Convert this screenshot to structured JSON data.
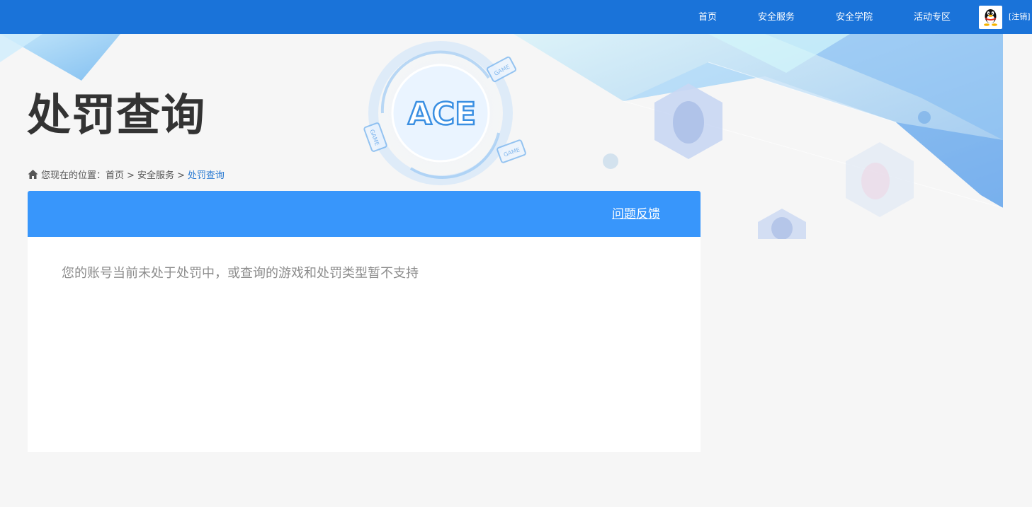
{
  "nav": {
    "items": [
      {
        "label": "首页"
      },
      {
        "label": "安全服务"
      },
      {
        "label": "安全学院"
      },
      {
        "label": "活动专区"
      }
    ],
    "logout_label": "[注销]",
    "avatar_icon": "qq-penguin-icon",
    "bar_color": "#1a73d9"
  },
  "banner": {
    "logo_text": "ACE",
    "badge_text": "GAME"
  },
  "page": {
    "title": "处罚查询"
  },
  "breadcrumb": {
    "prefix": "您现在的位置：",
    "items": [
      "首页",
      "安全服务",
      "处罚查询"
    ],
    "separator": ">",
    "home_icon": "home-icon"
  },
  "panel": {
    "header_color": "#3896fb",
    "feedback_label": "问题反馈",
    "message": "您的账号当前未处于处罚中，或查询的游戏和处罚类型暂不支持"
  }
}
